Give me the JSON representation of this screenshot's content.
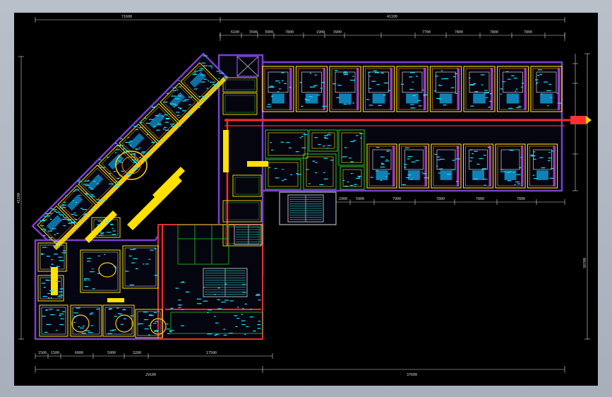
{
  "drawing": {
    "top_overall_dims": [
      "71600",
      "41100"
    ],
    "top_segment_dims": [
      "6100",
      "3500",
      "3900",
      "7800",
      "1900",
      "3900",
      "7700",
      "7800",
      "7800",
      "7800"
    ],
    "mid_segment_dims": [
      "2900",
      "5900",
      "7900",
      "7800",
      "7800",
      "7800"
    ],
    "bottom_segment_dims": [
      "1500",
      "1500",
      "6000",
      "5000",
      "3200",
      "17500"
    ],
    "bottom_overall_dims": [
      "29100",
      "37600"
    ],
    "left_overall_dim": "41100",
    "right_overall_dim": "38700"
  }
}
